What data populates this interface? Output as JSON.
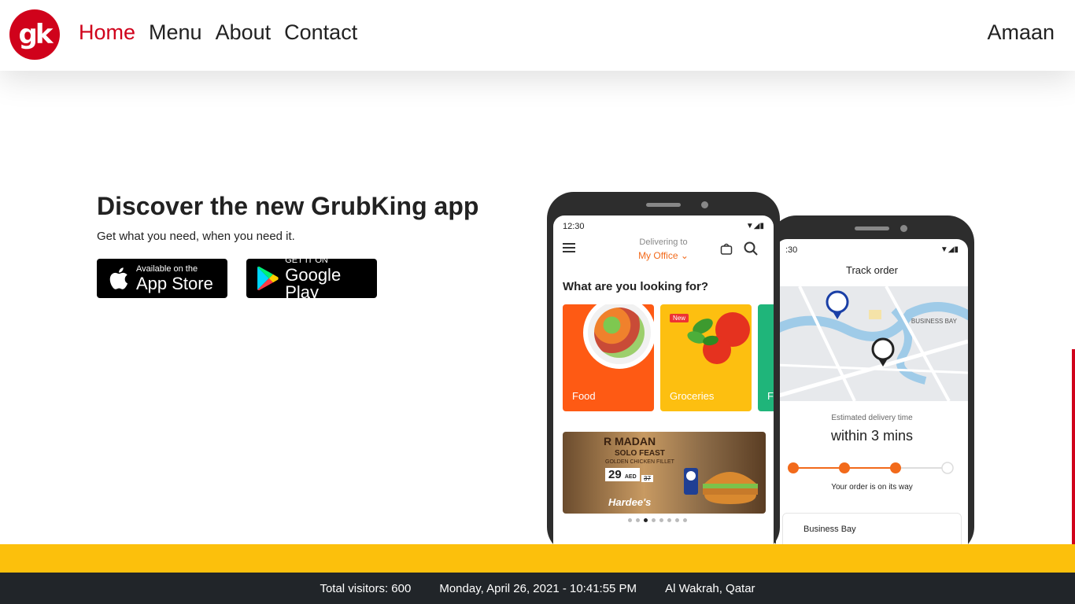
{
  "brand": {
    "logo_text": "gk"
  },
  "nav": {
    "links": [
      {
        "label": "Home",
        "active": true
      },
      {
        "label": "Menu"
      },
      {
        "label": "About"
      },
      {
        "label": "Contact"
      }
    ],
    "user": "Amaan"
  },
  "hero": {
    "title": "Discover the new GrubKing app",
    "subtitle": "Get what you need, when you need it.",
    "app_store": {
      "small": "Available on the",
      "big": "App Store",
      "icon": "apple-icon"
    },
    "google_play": {
      "small": "GET IT ON",
      "big": "Google Play",
      "icon": "play-icon"
    }
  },
  "phone1": {
    "time": "12:30",
    "delivering_label": "Delivering to",
    "delivering_value": "My Office",
    "question": "What are you looking for?",
    "categories": [
      {
        "label": "Food"
      },
      {
        "label": "Groceries",
        "badge": "New"
      },
      {
        "label": "F"
      }
    ],
    "banner": {
      "title": "R MADAN",
      "subtitle": "SOLO FEAST",
      "detail": "GOLDEN CHICKEN FILLET",
      "price": "29",
      "currency": "AED",
      "old_price": "37",
      "brand": "Hardee's"
    }
  },
  "phone2": {
    "time": ":30",
    "title": "Track order",
    "map_label": "BUSINESS BAY",
    "estimate_label": "Estimated delivery time",
    "estimate_value": "within 3 mins",
    "status": "Your order is on its way",
    "address": "Business Bay"
  },
  "footer": {
    "visitors": "Total visitors: 600",
    "datetime": "Monday, April 26, 2021 - 10:41:55 PM",
    "location": "Al Wakrah, Qatar"
  },
  "colors": {
    "brand_red": "#d0021b",
    "accent_orange": "#f26a1b",
    "footer_yellow": "#fcc00c",
    "footer_dark": "#212529"
  }
}
